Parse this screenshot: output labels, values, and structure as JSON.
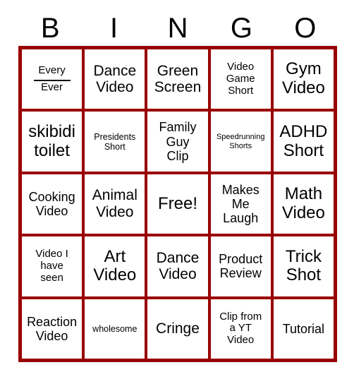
{
  "card": {
    "title": "BINGO",
    "header_letters": [
      "B",
      "I",
      "N",
      "G",
      "O"
    ],
    "border_color": "#990000",
    "text_color": "#000000",
    "background_color": "#ffffff",
    "rows": 5,
    "columns": 5,
    "free_space_index": 12,
    "cells": [
      {
        "line1": "Every",
        "line2": "Ever",
        "has_blank_rule": true,
        "size": "sm",
        "marked": false
      },
      {
        "text": "Dance\nVideo",
        "size": "lg",
        "marked": false
      },
      {
        "text": "Green\nScreen",
        "size": "lg",
        "marked": false
      },
      {
        "text": "Video\nGame\nShort",
        "size": "sm",
        "marked": false
      },
      {
        "text": "Gym\nVideo",
        "size": "xl",
        "marked": false
      },
      {
        "text": "skibidi\ntoilet",
        "size": "xl",
        "marked": false
      },
      {
        "text": "Presidents\nShort",
        "size": "xs",
        "marked": false
      },
      {
        "text": "Family\nGuy\nClip",
        "size": "md",
        "marked": false
      },
      {
        "text": "Speedrunning\nShorts",
        "size": "xxs",
        "marked": false
      },
      {
        "text": "ADHD\nShort",
        "size": "xl",
        "marked": false
      },
      {
        "text": "Cooking\nVideo",
        "size": "md",
        "marked": false
      },
      {
        "text": "Animal\nVideo",
        "size": "lg",
        "marked": false
      },
      {
        "text": "Free!",
        "size": "xl",
        "marked": false
      },
      {
        "text": "Makes\nMe\nLaugh",
        "size": "md",
        "marked": false
      },
      {
        "text": "Math\nVideo",
        "size": "xl",
        "marked": false
      },
      {
        "text": "Video I\nhave\nseen",
        "size": "sm",
        "marked": false
      },
      {
        "text": "Art\nVideo",
        "size": "xl",
        "marked": false
      },
      {
        "text": "Dance\nVideo",
        "size": "lg",
        "marked": false
      },
      {
        "text": "Product\nReview",
        "size": "md",
        "marked": false
      },
      {
        "text": "Trick\nShot",
        "size": "xl",
        "marked": false
      },
      {
        "text": "Reaction\nVideo",
        "size": "md",
        "marked": false
      },
      {
        "text": "wholesome",
        "size": "xs",
        "marked": false
      },
      {
        "text": "Cringe",
        "size": "lg",
        "marked": false
      },
      {
        "text": "Clip from\na YT\nVideo",
        "size": "sm",
        "marked": false
      },
      {
        "text": "Tutorial",
        "size": "md",
        "marked": false
      }
    ]
  }
}
